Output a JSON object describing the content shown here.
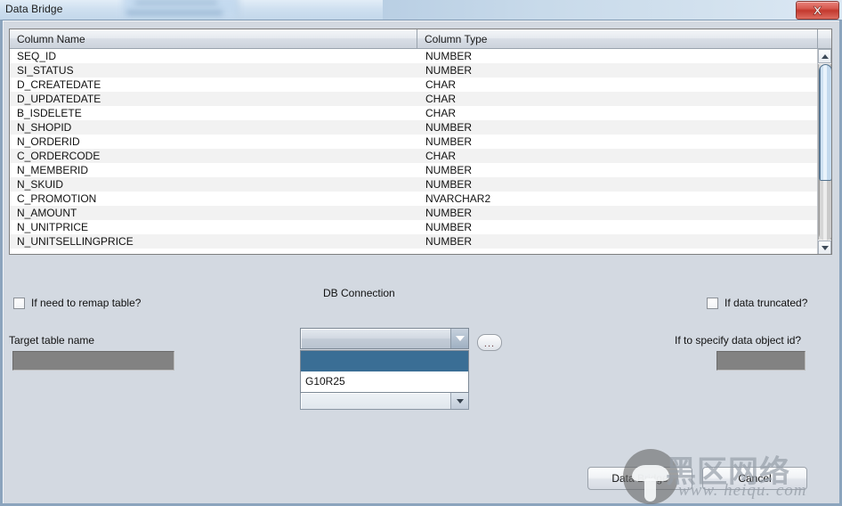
{
  "window": {
    "title": "Data Bridge",
    "close_label": "x",
    "close_icon": "close-icon"
  },
  "table": {
    "columns": [
      "Column Name",
      "Column Type"
    ],
    "rows": [
      [
        "SEQ_ID",
        "NUMBER"
      ],
      [
        "SI_STATUS",
        "NUMBER"
      ],
      [
        "D_CREATEDATE",
        "CHAR"
      ],
      [
        "D_UPDATEDATE",
        "CHAR"
      ],
      [
        "B_ISDELETE",
        "CHAR"
      ],
      [
        "N_SHOPID",
        "NUMBER"
      ],
      [
        "N_ORDERID",
        "NUMBER"
      ],
      [
        "C_ORDERCODE",
        "CHAR"
      ],
      [
        "N_MEMBERID",
        "NUMBER"
      ],
      [
        "N_SKUID",
        "NUMBER"
      ],
      [
        "C_PROMOTION",
        "NVARCHAR2"
      ],
      [
        "N_AMOUNT",
        "NUMBER"
      ],
      [
        "N_UNITPRICE",
        "NUMBER"
      ],
      [
        "N_UNITSELLINGPRICE",
        "NUMBER"
      ]
    ],
    "scrollbar": {
      "up_icon": "arrow-up-icon",
      "down_icon": "arrow-down-icon"
    }
  },
  "form": {
    "remap_checkbox_label": "If need to remap table?",
    "remap_checked": false,
    "target_table_label": "Target table name",
    "target_table_value": "",
    "db_connection_label": "DB Connection",
    "db_connection_value": "",
    "db_connection_options": [
      "",
      "G10R25"
    ],
    "db_connection_selected_index": 0,
    "browse_button_label": "...",
    "second_combo_value": "",
    "truncated_checkbox_label": "If data truncated?",
    "truncated_checked": false,
    "data_object_id_label": "If to specify data object id?",
    "data_object_id_value": ""
  },
  "buttons": {
    "data_bridge": "Data Bridge",
    "cancel": "Cancel"
  },
  "watermark": {
    "site_cn": "黑区网络",
    "site_url": "www. heiqu. com"
  },
  "colors": {
    "dialog_bg": "#d3d9e1",
    "frame_border": "#8ba4bd",
    "close_red": "#c3392e",
    "dropdown_highlight": "#3a6e95",
    "disabled_field": "#828282",
    "row_alt": "#f2f2f2"
  }
}
